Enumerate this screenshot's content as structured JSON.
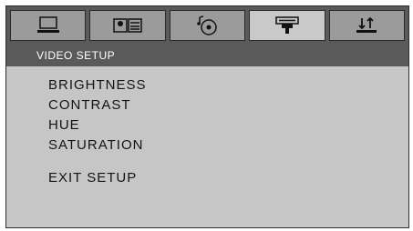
{
  "header": {
    "tabs": [
      {
        "icon": "monitor-icon",
        "active": false
      },
      {
        "icon": "speaker-icon",
        "active": false
      },
      {
        "icon": "audio-disc-icon",
        "active": false
      },
      {
        "icon": "video-camera-icon",
        "active": true
      },
      {
        "icon": "updown-arrows-icon",
        "active": false
      }
    ]
  },
  "section": {
    "title": "VIDEO SETUP"
  },
  "menu": {
    "items": [
      {
        "label": "BRIGHTNESS"
      },
      {
        "label": "CONTRAST"
      },
      {
        "label": "HUE"
      },
      {
        "label": "SATURATION"
      }
    ],
    "exit_label": "EXIT SETUP"
  },
  "colors": {
    "frame": "#5a5a5a",
    "panel": "#c6c6c6",
    "tab_inactive": "#9b9b9b",
    "tab_active": "#c9c9c9",
    "title_text": "#ffffff",
    "item_text": "#141414"
  }
}
